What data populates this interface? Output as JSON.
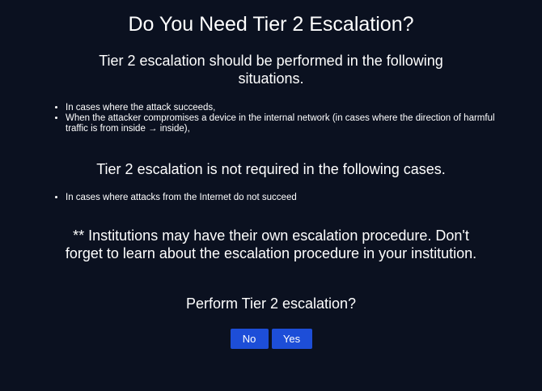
{
  "dialog": {
    "title": "Do You Need Tier 2 Escalation?",
    "intro": "Tier 2 escalation should be performed in the following situations.",
    "required_cases": [
      "In cases where the attack succeeds,",
      "When the attacker compromises a device in the internal network (in cases where the direction of harmful traffic is from inside → inside),"
    ],
    "not_required_heading": "Tier 2 escalation is not required in the following cases.",
    "not_required_cases": [
      "In cases where attacks from the Internet do not succeed"
    ],
    "note": "** Institutions may have their own escalation procedure. Don't forget to learn about the escalation procedure in your institution.",
    "question": "Perform Tier 2 escalation?",
    "buttons": {
      "no_label": "No",
      "yes_label": "Yes"
    }
  },
  "colors": {
    "background": "#0b1120",
    "button": "#1d4ed8",
    "text": "#ffffff"
  }
}
